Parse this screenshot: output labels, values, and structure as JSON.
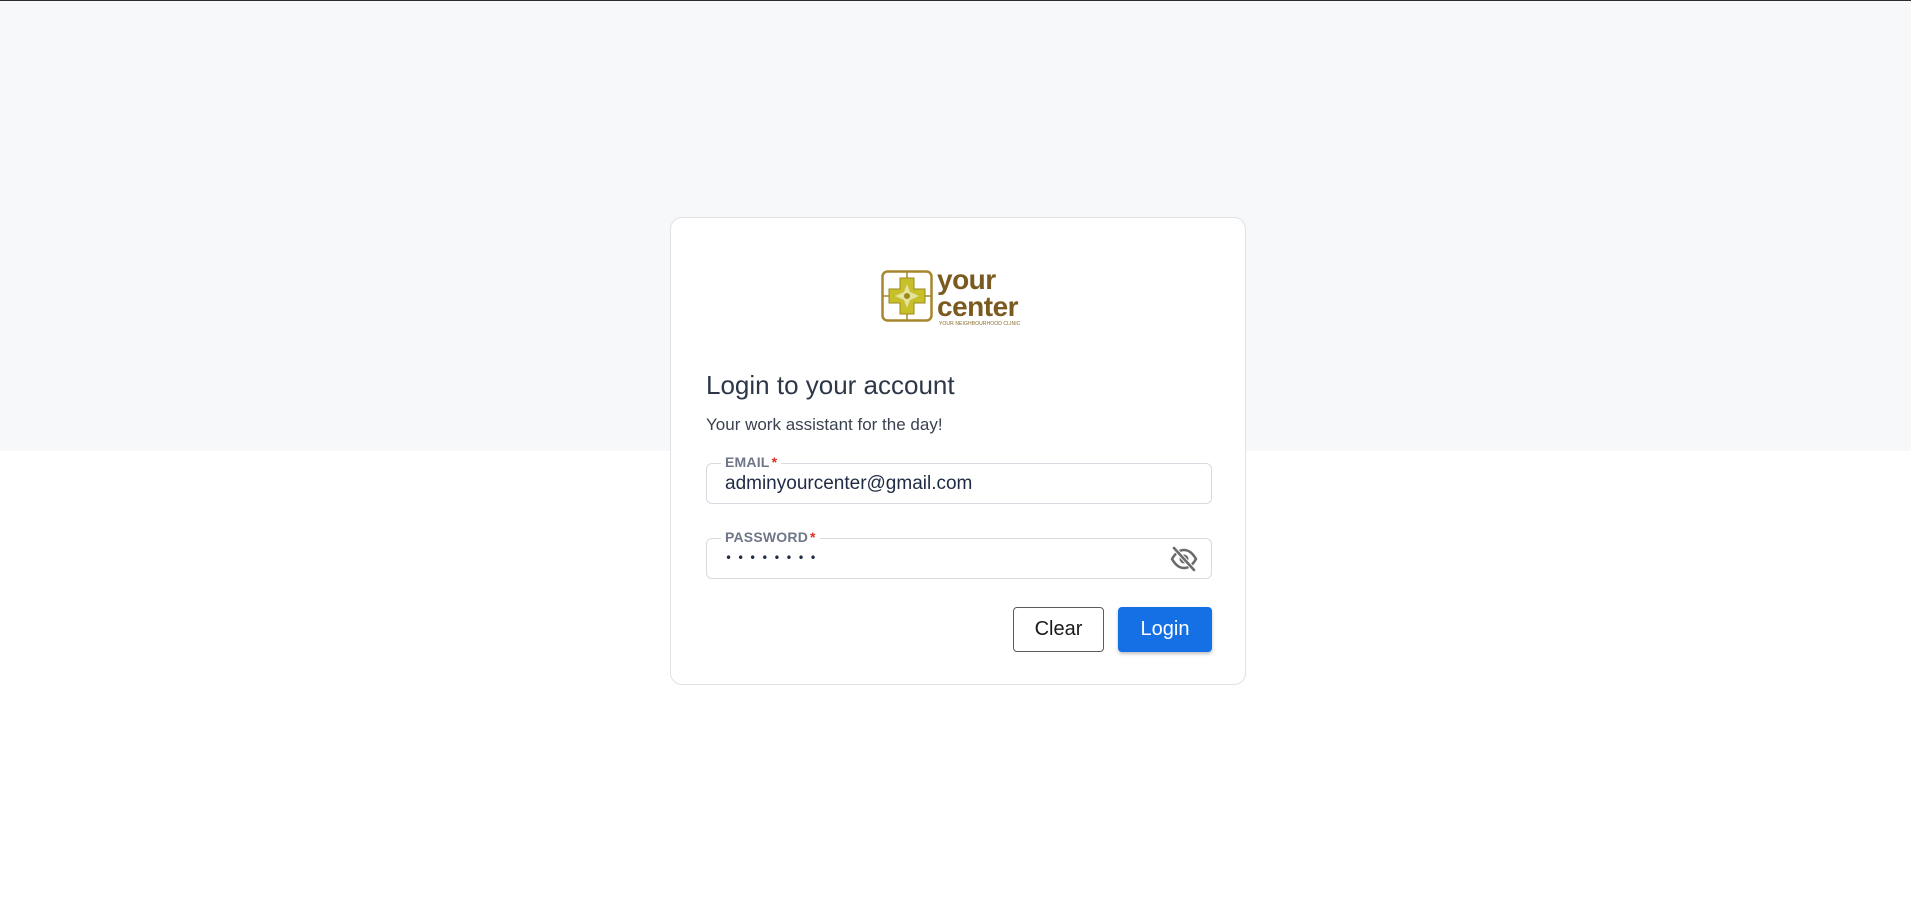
{
  "brand": {
    "logo_word_line1": "your",
    "logo_word_line2": "center",
    "logo_tagline": "YOUR NEIGHBOURHOOD CLINIC",
    "logo_icon": "clinic-cross-logo-icon",
    "colors": {
      "logo_text": "#7b5a1f",
      "logo_mark": "#c8c02a"
    }
  },
  "login": {
    "title": "Login to your account",
    "subtitle": "Your work assistant for the day!",
    "email": {
      "label": "EMAIL",
      "required_mark": "*",
      "value": "adminyourcenter@gmail.com"
    },
    "password": {
      "label": "PASSWORD",
      "required_mark": "*",
      "masked_value": "••••••••",
      "toggle_icon": "eye-slash-icon"
    },
    "buttons": {
      "clear_label": "Clear",
      "login_label": "Login"
    }
  },
  "colors": {
    "accent": "#1570e6",
    "required": "#d93025",
    "page_top_background": "#f7f8fa",
    "page_bottom_background": "#ffffff"
  }
}
